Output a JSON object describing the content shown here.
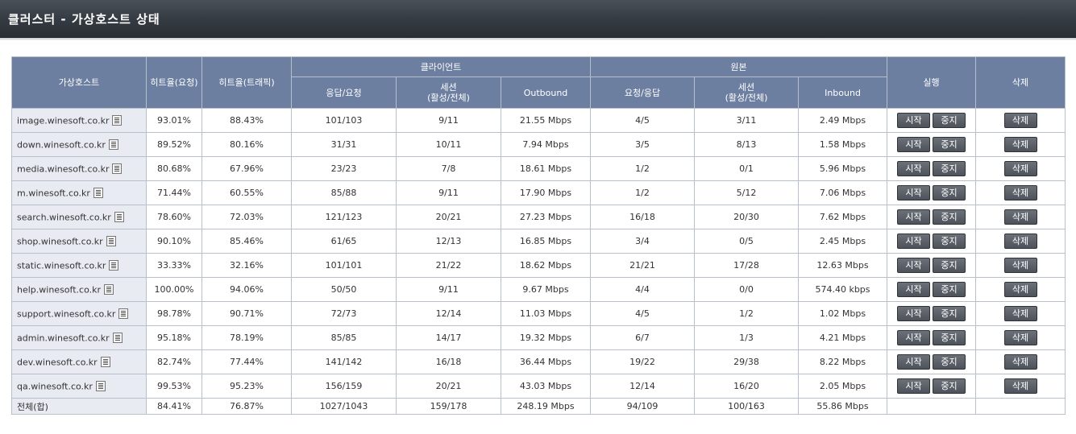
{
  "page": {
    "title": "클러스터 - 가상호스트 상태"
  },
  "columns": {
    "host": "가상호스트",
    "hit_request": "히트율(요청)",
    "hit_traffic": "히트율(트래픽)",
    "client": "클라이언트",
    "origin": "원본",
    "client_response": "응답/요청",
    "client_session": "세션",
    "client_session_sub": "(활성/전체)",
    "client_outbound": "Outbound",
    "origin_request": "요청/응답",
    "origin_session": "세션",
    "origin_session_sub": "(활성/전체)",
    "origin_inbound": "Inbound",
    "run": "실행",
    "delete": "삭제"
  },
  "buttons": {
    "start": "시작",
    "stop": "중지",
    "delete": "삭제"
  },
  "rows": [
    {
      "host": "image.winesoft.co.kr",
      "hit_request": "93.01%",
      "hit_traffic": "88.43%",
      "client_response": "101/103",
      "client_session": "9/11",
      "outbound": "21.55 Mbps",
      "origin_request": "4/5",
      "origin_session": "3/11",
      "inbound": "2.49 Mbps"
    },
    {
      "host": "down.winesoft.co.kr",
      "hit_request": "89.52%",
      "hit_traffic": "80.16%",
      "client_response": "31/31",
      "client_session": "10/11",
      "outbound": "7.94 Mbps",
      "origin_request": "3/5",
      "origin_session": "8/13",
      "inbound": "1.58 Mbps"
    },
    {
      "host": "media.winesoft.co.kr",
      "hit_request": "80.68%",
      "hit_traffic": "67.96%",
      "client_response": "23/23",
      "client_session": "7/8",
      "outbound": "18.61 Mbps",
      "origin_request": "1/2",
      "origin_session": "0/1",
      "inbound": "5.96 Mbps"
    },
    {
      "host": "m.winesoft.co.kr",
      "hit_request": "71.44%",
      "hit_traffic": "60.55%",
      "client_response": "85/88",
      "client_session": "9/11",
      "outbound": "17.90 Mbps",
      "origin_request": "1/2",
      "origin_session": "5/12",
      "inbound": "7.06 Mbps"
    },
    {
      "host": "search.winesoft.co.kr",
      "hit_request": "78.60%",
      "hit_traffic": "72.03%",
      "client_response": "121/123",
      "client_session": "20/21",
      "outbound": "27.23 Mbps",
      "origin_request": "16/18",
      "origin_session": "20/30",
      "inbound": "7.62 Mbps"
    },
    {
      "host": "shop.winesoft.co.kr",
      "hit_request": "90.10%",
      "hit_traffic": "85.46%",
      "client_response": "61/65",
      "client_session": "12/13",
      "outbound": "16.85 Mbps",
      "origin_request": "3/4",
      "origin_session": "0/5",
      "inbound": "2.45 Mbps"
    },
    {
      "host": "static.winesoft.co.kr",
      "hit_request": "33.33%",
      "hit_traffic": "32.16%",
      "client_response": "101/101",
      "client_session": "21/22",
      "outbound": "18.62 Mbps",
      "origin_request": "21/21",
      "origin_session": "17/28",
      "inbound": "12.63 Mbps"
    },
    {
      "host": "help.winesoft.co.kr",
      "hit_request": "100.00%",
      "hit_traffic": "94.06%",
      "client_response": "50/50",
      "client_session": "9/11",
      "outbound": "9.67 Mbps",
      "origin_request": "4/4",
      "origin_session": "0/0",
      "inbound": "574.40 kbps"
    },
    {
      "host": "support.winesoft.co.kr",
      "hit_request": "98.78%",
      "hit_traffic": "90.71%",
      "client_response": "72/73",
      "client_session": "12/14",
      "outbound": "11.03 Mbps",
      "origin_request": "4/5",
      "origin_session": "1/2",
      "inbound": "1.02 Mbps"
    },
    {
      "host": "admin.winesoft.co.kr",
      "hit_request": "95.18%",
      "hit_traffic": "78.19%",
      "client_response": "85/85",
      "client_session": "14/17",
      "outbound": "19.32 Mbps",
      "origin_request": "6/7",
      "origin_session": "1/3",
      "inbound": "4.21 Mbps"
    },
    {
      "host": "dev.winesoft.co.kr",
      "hit_request": "82.74%",
      "hit_traffic": "77.44%",
      "client_response": "141/142",
      "client_session": "16/18",
      "outbound": "36.44 Mbps",
      "origin_request": "19/22",
      "origin_session": "29/38",
      "inbound": "8.22 Mbps"
    },
    {
      "host": "qa.winesoft.co.kr",
      "hit_request": "99.53%",
      "hit_traffic": "95.23%",
      "client_response": "156/159",
      "client_session": "20/21",
      "outbound": "43.03 Mbps",
      "origin_request": "12/14",
      "origin_session": "16/20",
      "inbound": "2.05 Mbps"
    }
  ],
  "total": {
    "label": "전체(합)",
    "hit_request": "84.41%",
    "hit_traffic": "76.87%",
    "client_response": "1027/1043",
    "client_session": "159/178",
    "outbound": "248.19 Mbps",
    "origin_request": "94/109",
    "origin_session": "100/163",
    "inbound": "55.86 Mbps"
  },
  "colors": {
    "header_bg": "#6d7fa1",
    "title_bar": "#343a41",
    "host_cell_bg": "#e8ebf2",
    "button_bg": "#5a5f67"
  },
  "icons": {
    "host_detail": "list-icon"
  }
}
